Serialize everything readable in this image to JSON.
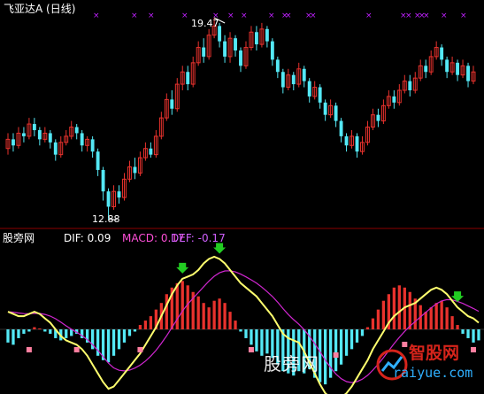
{
  "colors": {
    "up": "#e8322d",
    "down": "#54e8f5",
    "dif_line": "#ffff6e",
    "dea_line": "#d026d0",
    "signal": "#22cc22",
    "marker": "#c020ff",
    "axis": "#8b0000"
  },
  "header": {
    "title": "飞亚达A (日线)"
  },
  "indicator": {
    "source": "股旁网",
    "dif": "DIF: 0.09",
    "macd": "MACD: 0.17",
    "def": "DEF: -0.17"
  },
  "annotations": {
    "high": "19.47",
    "low": "12.88"
  },
  "watermark": {
    "text": "股旁网",
    "brand": "智股网",
    "site": "raiyue.com"
  },
  "chart_data": {
    "type": "candlestick",
    "high_label": 19.47,
    "low_label": 12.88,
    "candles": [
      {
        "o": 15.2,
        "c": 15.5,
        "h": 15.7,
        "l": 15.0
      },
      {
        "o": 15.5,
        "c": 15.3,
        "h": 15.7,
        "l": 15.1
      },
      {
        "o": 15.3,
        "c": 15.7,
        "h": 15.9,
        "l": 15.2
      },
      {
        "o": 15.7,
        "c": 15.6,
        "h": 15.9,
        "l": 15.4
      },
      {
        "o": 15.6,
        "c": 16.0,
        "h": 16.2,
        "l": 15.5
      },
      {
        "o": 16.0,
        "c": 15.8,
        "h": 16.2,
        "l": 15.6
      },
      {
        "o": 15.8,
        "c": 15.5,
        "h": 15.9,
        "l": 15.3
      },
      {
        "o": 15.5,
        "c": 15.7,
        "h": 15.9,
        "l": 15.4
      },
      {
        "o": 15.7,
        "c": 15.4,
        "h": 15.8,
        "l": 15.2
      },
      {
        "o": 15.4,
        "c": 15.0,
        "h": 15.5,
        "l": 14.8
      },
      {
        "o": 15.0,
        "c": 15.4,
        "h": 15.6,
        "l": 14.9
      },
      {
        "o": 15.4,
        "c": 15.6,
        "h": 15.8,
        "l": 15.3
      },
      {
        "o": 15.6,
        "c": 15.9,
        "h": 16.1,
        "l": 15.5
      },
      {
        "o": 15.9,
        "c": 15.7,
        "h": 16.0,
        "l": 15.5
      },
      {
        "o": 15.7,
        "c": 15.3,
        "h": 15.8,
        "l": 15.1
      },
      {
        "o": 15.3,
        "c": 15.5,
        "h": 15.6,
        "l": 15.1
      },
      {
        "o": 15.5,
        "c": 15.1,
        "h": 15.6,
        "l": 14.9
      },
      {
        "o": 15.1,
        "c": 14.5,
        "h": 15.2,
        "l": 14.3
      },
      {
        "o": 14.5,
        "c": 13.8,
        "h": 14.6,
        "l": 13.5
      },
      {
        "o": 13.8,
        "c": 13.3,
        "h": 13.9,
        "l": 12.88
      },
      {
        "o": 13.3,
        "c": 13.8,
        "h": 14.0,
        "l": 13.2
      },
      {
        "o": 13.8,
        "c": 13.6,
        "h": 14.0,
        "l": 13.4
      },
      {
        "o": 13.6,
        "c": 14.2,
        "h": 14.4,
        "l": 13.5
      },
      {
        "o": 14.2,
        "c": 14.6,
        "h": 14.8,
        "l": 14.1
      },
      {
        "o": 14.6,
        "c": 14.4,
        "h": 14.9,
        "l": 14.2
      },
      {
        "o": 14.4,
        "c": 14.9,
        "h": 15.1,
        "l": 14.3
      },
      {
        "o": 14.9,
        "c": 15.2,
        "h": 15.4,
        "l": 14.8
      },
      {
        "o": 15.2,
        "c": 15.0,
        "h": 15.4,
        "l": 14.9
      },
      {
        "o": 15.0,
        "c": 15.6,
        "h": 15.8,
        "l": 14.9
      },
      {
        "o": 15.6,
        "c": 16.2,
        "h": 16.4,
        "l": 15.5
      },
      {
        "o": 16.2,
        "c": 16.8,
        "h": 17.0,
        "l": 16.1
      },
      {
        "o": 16.8,
        "c": 16.5,
        "h": 17.1,
        "l": 16.3
      },
      {
        "o": 16.5,
        "c": 17.3,
        "h": 17.5,
        "l": 16.4
      },
      {
        "o": 17.3,
        "c": 17.7,
        "h": 17.9,
        "l": 17.1
      },
      {
        "o": 17.7,
        "c": 17.3,
        "h": 17.9,
        "l": 17.1
      },
      {
        "o": 17.3,
        "c": 18.0,
        "h": 18.2,
        "l": 17.2
      },
      {
        "o": 18.0,
        "c": 18.5,
        "h": 18.7,
        "l": 17.9
      },
      {
        "o": 18.5,
        "c": 18.2,
        "h": 18.8,
        "l": 18.0
      },
      {
        "o": 18.2,
        "c": 18.9,
        "h": 19.1,
        "l": 18.1
      },
      {
        "o": 18.9,
        "c": 19.2,
        "h": 19.47,
        "l": 18.8
      },
      {
        "o": 19.2,
        "c": 18.7,
        "h": 19.3,
        "l": 18.5
      },
      {
        "o": 18.7,
        "c": 18.2,
        "h": 18.9,
        "l": 18.0
      },
      {
        "o": 18.2,
        "c": 18.8,
        "h": 19.0,
        "l": 18.0
      },
      {
        "o": 18.8,
        "c": 18.4,
        "h": 18.9,
        "l": 18.2
      },
      {
        "o": 18.4,
        "c": 17.9,
        "h": 18.5,
        "l": 17.7
      },
      {
        "o": 17.9,
        "c": 18.5,
        "h": 18.7,
        "l": 17.8
      },
      {
        "o": 18.5,
        "c": 19.0,
        "h": 19.2,
        "l": 18.4
      },
      {
        "o": 19.0,
        "c": 18.6,
        "h": 19.2,
        "l": 18.4
      },
      {
        "o": 18.6,
        "c": 19.1,
        "h": 19.3,
        "l": 18.5
      },
      {
        "o": 19.1,
        "c": 18.7,
        "h": 19.2,
        "l": 18.5
      },
      {
        "o": 18.7,
        "c": 18.1,
        "h": 18.8,
        "l": 17.9
      },
      {
        "o": 18.1,
        "c": 17.7,
        "h": 18.2,
        "l": 17.5
      },
      {
        "o": 17.7,
        "c": 17.2,
        "h": 17.8,
        "l": 17.0
      },
      {
        "o": 17.2,
        "c": 17.6,
        "h": 17.8,
        "l": 17.1
      },
      {
        "o": 17.6,
        "c": 17.3,
        "h": 17.7,
        "l": 17.1
      },
      {
        "o": 17.3,
        "c": 17.8,
        "h": 18.0,
        "l": 17.2
      },
      {
        "o": 17.8,
        "c": 17.4,
        "h": 17.9,
        "l": 17.2
      },
      {
        "o": 17.4,
        "c": 16.9,
        "h": 17.5,
        "l": 16.7
      },
      {
        "o": 16.9,
        "c": 17.2,
        "h": 17.4,
        "l": 16.8
      },
      {
        "o": 17.2,
        "c": 16.7,
        "h": 17.3,
        "l": 16.5
      },
      {
        "o": 16.7,
        "c": 16.3,
        "h": 16.8,
        "l": 16.1
      },
      {
        "o": 16.3,
        "c": 16.6,
        "h": 16.8,
        "l": 16.2
      },
      {
        "o": 16.6,
        "c": 16.1,
        "h": 16.7,
        "l": 15.9
      },
      {
        "o": 16.1,
        "c": 15.6,
        "h": 16.2,
        "l": 15.4
      },
      {
        "o": 15.6,
        "c": 15.3,
        "h": 15.7,
        "l": 15.1
      },
      {
        "o": 15.3,
        "c": 15.6,
        "h": 15.8,
        "l": 15.2
      },
      {
        "o": 15.6,
        "c": 15.1,
        "h": 15.7,
        "l": 14.9
      },
      {
        "o": 15.1,
        "c": 15.4,
        "h": 15.6,
        "l": 15.0
      },
      {
        "o": 15.4,
        "c": 15.9,
        "h": 16.1,
        "l": 15.3
      },
      {
        "o": 15.9,
        "c": 16.3,
        "h": 16.5,
        "l": 15.8
      },
      {
        "o": 16.3,
        "c": 16.1,
        "h": 16.5,
        "l": 15.9
      },
      {
        "o": 16.1,
        "c": 16.6,
        "h": 16.8,
        "l": 16.0
      },
      {
        "o": 16.6,
        "c": 16.9,
        "h": 17.1,
        "l": 16.5
      },
      {
        "o": 16.9,
        "c": 16.7,
        "h": 17.1,
        "l": 16.5
      },
      {
        "o": 16.7,
        "c": 17.1,
        "h": 17.3,
        "l": 16.6
      },
      {
        "o": 17.1,
        "c": 17.4,
        "h": 17.6,
        "l": 17.0
      },
      {
        "o": 17.4,
        "c": 17.1,
        "h": 17.6,
        "l": 16.9
      },
      {
        "o": 17.1,
        "c": 17.5,
        "h": 17.7,
        "l": 17.0
      },
      {
        "o": 17.5,
        "c": 17.9,
        "h": 18.1,
        "l": 17.4
      },
      {
        "o": 17.9,
        "c": 17.7,
        "h": 18.1,
        "l": 17.5
      },
      {
        "o": 17.7,
        "c": 18.2,
        "h": 18.4,
        "l": 17.6
      },
      {
        "o": 18.2,
        "c": 18.5,
        "h": 18.7,
        "l": 18.1
      },
      {
        "o": 18.5,
        "c": 18.1,
        "h": 18.6,
        "l": 17.9
      },
      {
        "o": 18.1,
        "c": 17.7,
        "h": 18.2,
        "l": 17.5
      },
      {
        "o": 17.7,
        "c": 18.0,
        "h": 18.2,
        "l": 17.6
      },
      {
        "o": 18.0,
        "c": 17.6,
        "h": 18.1,
        "l": 17.4
      },
      {
        "o": 17.6,
        "c": 17.9,
        "h": 18.1,
        "l": 17.5
      },
      {
        "o": 17.9,
        "c": 17.4,
        "h": 18.0,
        "l": 17.2
      },
      {
        "o": 17.4,
        "c": 17.7,
        "h": 17.9,
        "l": 17.3
      }
    ],
    "macd": {
      "hist": [
        -0.3,
        -0.35,
        -0.2,
        -0.1,
        -0.05,
        0.05,
        0.02,
        -0.05,
        -0.1,
        -0.2,
        -0.25,
        -0.2,
        -0.15,
        -0.1,
        -0.2,
        -0.3,
        -0.45,
        -0.6,
        -0.7,
        -0.75,
        -0.6,
        -0.45,
        -0.3,
        -0.15,
        -0.05,
        0.1,
        0.2,
        0.3,
        0.45,
        0.6,
        0.8,
        0.95,
        1.05,
        1.1,
        1.0,
        0.85,
        0.75,
        0.6,
        0.5,
        0.65,
        0.7,
        0.6,
        0.4,
        0.2,
        -0.05,
        -0.2,
        -0.35,
        -0.5,
        -0.6,
        -0.55,
        -0.65,
        -0.8,
        -0.95,
        -1.0,
        -1.05,
        -0.95,
        -1.0,
        -0.9,
        -1.1,
        -1.2,
        -1.25,
        -1.1,
        -0.95,
        -0.8,
        -0.6,
        -0.45,
        -0.3,
        -0.15,
        0.05,
        0.25,
        0.45,
        0.65,
        0.8,
        0.95,
        1.0,
        0.95,
        0.85,
        0.7,
        0.55,
        0.4,
        0.5,
        0.6,
        0.65,
        0.5,
        0.3,
        0.1,
        -0.1,
        -0.2,
        -0.3,
        -0.25
      ],
      "dif": [
        0.4,
        0.35,
        0.3,
        0.3,
        0.35,
        0.4,
        0.35,
        0.25,
        0.15,
        0.0,
        -0.15,
        -0.25,
        -0.3,
        -0.35,
        -0.45,
        -0.6,
        -0.8,
        -1.0,
        -1.2,
        -1.35,
        -1.3,
        -1.15,
        -1.0,
        -0.85,
        -0.7,
        -0.55,
        -0.35,
        -0.15,
        0.05,
        0.3,
        0.55,
        0.8,
        1.0,
        1.15,
        1.2,
        1.25,
        1.35,
        1.5,
        1.6,
        1.65,
        1.6,
        1.5,
        1.35,
        1.2,
        1.05,
        0.95,
        0.85,
        0.75,
        0.6,
        0.45,
        0.3,
        0.1,
        -0.1,
        -0.2,
        -0.25,
        -0.3,
        -0.5,
        -0.75,
        -1.0,
        -1.25,
        -1.45,
        -1.55,
        -1.6,
        -1.55,
        -1.45,
        -1.3,
        -1.1,
        -0.9,
        -0.7,
        -0.45,
        -0.25,
        -0.05,
        0.15,
        0.3,
        0.4,
        0.5,
        0.55,
        0.6,
        0.7,
        0.8,
        0.9,
        0.95,
        0.9,
        0.8,
        0.65,
        0.5,
        0.4,
        0.3,
        0.25,
        0.15
      ]
    }
  }
}
